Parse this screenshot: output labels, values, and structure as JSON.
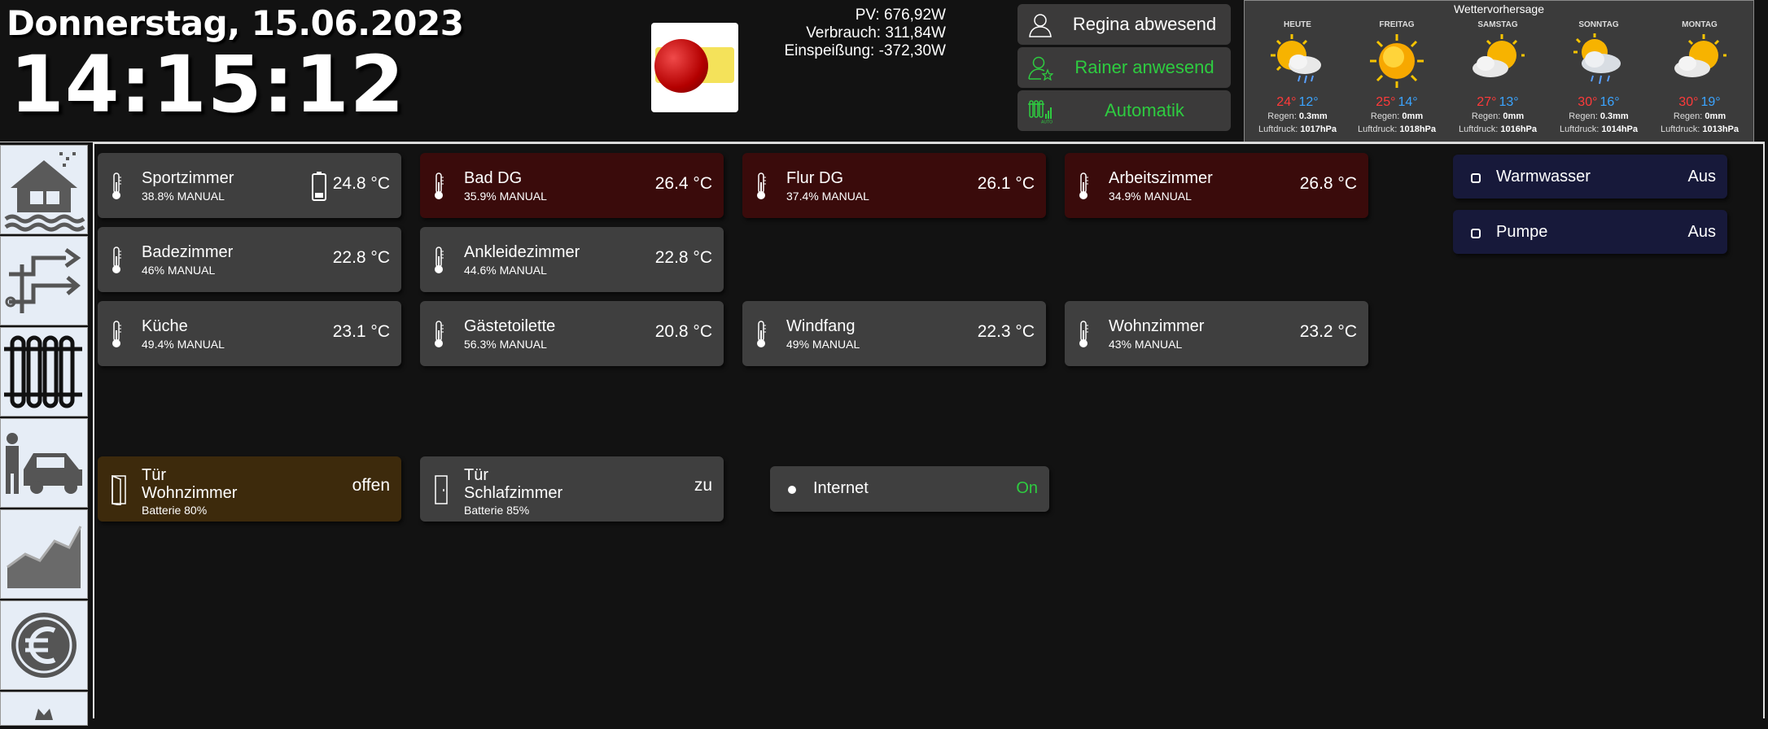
{
  "header": {
    "date": "Donnerstag, 15.06.2023",
    "time": "14:15:12",
    "energy": {
      "pv": "PV: 676,92W",
      "verbrauch": "Verbrauch: 311,84W",
      "einspeisung": "Einspeißung: -372,30W"
    }
  },
  "presence": [
    {
      "label": "Regina abwesend",
      "color": "#ffffff"
    },
    {
      "label": "Rainer anwesend",
      "color": "#2ecc40"
    },
    {
      "label": "Automatik",
      "color": "#2ecc40"
    }
  ],
  "weather": {
    "title": "Wettervorhersage",
    "days": [
      {
        "name": "HEUTE",
        "icon": "sun-cloud-rain-icon",
        "high": "24°",
        "low": "12°",
        "rain_label": "Regen:",
        "rain": "0.3mm",
        "pressure_label": "Luftdruck:",
        "pressure": "1017hPa"
      },
      {
        "name": "FREITAG",
        "icon": "sun-icon",
        "high": "25°",
        "low": "14°",
        "rain_label": "Regen:",
        "rain": "0mm",
        "pressure_label": "Luftdruck:",
        "pressure": "1018hPa"
      },
      {
        "name": "SAMSTAG",
        "icon": "sun-cloud-icon",
        "high": "27°",
        "low": "13°",
        "rain_label": "Regen:",
        "rain": "0mm",
        "pressure_label": "Luftdruck:",
        "pressure": "1016hPa"
      },
      {
        "name": "SONNTAG",
        "icon": "sun-cloud-rain-icon",
        "high": "30°",
        "low": "16°",
        "rain_label": "Regen:",
        "rain": "0.3mm",
        "pressure_label": "Luftdruck:",
        "pressure": "1014hPa"
      },
      {
        "name": "MONTAG",
        "icon": "sun-cloud-icon",
        "high": "30°",
        "low": "19°",
        "rain_label": "Regen:",
        "rain": "0mm",
        "pressure_label": "Luftdruck:",
        "pressure": "1013hPa"
      }
    ]
  },
  "sidebar": {
    "items": [
      {
        "icon": "house-flood-icon"
      },
      {
        "icon": "pipes-icon"
      },
      {
        "icon": "radiator-icon"
      },
      {
        "icon": "person-car-icon"
      },
      {
        "icon": "chart-area-icon"
      },
      {
        "icon": "euro-icon"
      }
    ]
  },
  "rooms": [
    {
      "name": "Sportzimmer",
      "sub": "38.8% MANUAL",
      "value": "24.8 °C",
      "style": "grey",
      "battery": true
    },
    {
      "name": "Bad DG",
      "sub": "35.9% MANUAL",
      "value": "26.4 °C",
      "style": "red"
    },
    {
      "name": "Flur DG",
      "sub": "37.4% MANUAL",
      "value": "26.1 °C",
      "style": "red"
    },
    {
      "name": "Arbeitszimmer",
      "sub": "34.9% MANUAL",
      "value": "26.8 °C",
      "style": "red"
    },
    {
      "name": "Badezimmer",
      "sub": "46% MANUAL",
      "value": "22.8 °C",
      "style": "grey"
    },
    {
      "name": "Ankleidezimmer",
      "sub": "44.6% MANUAL",
      "value": "22.8 °C",
      "style": "grey"
    },
    {
      "name": "Küche",
      "sub": "49.4% MANUAL",
      "value": "23.1 °C",
      "style": "grey"
    },
    {
      "name": "Gästetoilette",
      "sub": "56.3% MANUAL",
      "value": "20.8 °C",
      "style": "grey"
    },
    {
      "name": "Windfang",
      "sub": "49% MANUAL",
      "value": "22.3 °C",
      "style": "grey"
    },
    {
      "name": "Wohnzimmer",
      "sub": "43% MANUAL",
      "value": "23.2 °C",
      "style": "grey"
    }
  ],
  "doors": [
    {
      "line1": "Tür",
      "line2": "Wohnzimmer",
      "sub": "Batterie 80%",
      "value": "offen",
      "style": "brown"
    },
    {
      "line1": "Tür",
      "line2": "Schlafzimmer",
      "sub": "Batterie 85%",
      "value": "zu",
      "style": "grey"
    }
  ],
  "switches": {
    "internet": {
      "name": "Internet",
      "value": "On",
      "value_color": "#2ecc40"
    },
    "warmwasser": {
      "name": "Warmwasser",
      "value": "Aus"
    },
    "pumpe": {
      "name": "Pumpe",
      "value": "Aus"
    }
  },
  "colors": {
    "temp_high": "#ff3a3a",
    "temp_low": "#3ba4ff",
    "accent_green": "#2ecc40"
  }
}
